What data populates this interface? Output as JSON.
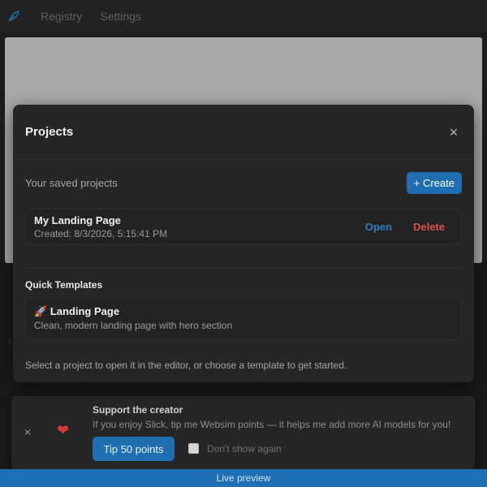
{
  "topbar": {
    "logo_icon": "feather-icon",
    "accent": "#1f6fb0",
    "nav": [
      "Registry",
      "Settings"
    ]
  },
  "modal": {
    "title": "Projects",
    "close_label": "×",
    "saved_label": "Your saved projects",
    "create_label": "+ Create",
    "projects": [
      {
        "name": "My Landing Page",
        "created": "Created: 8/3/2026, 5:15:41 PM",
        "open_label": "Open",
        "delete_label": "Delete"
      }
    ],
    "templates_heading": "Quick Templates",
    "templates": [
      {
        "emoji": "🚀",
        "name": "Landing Page",
        "description": "Clean, modern landing page with hero section"
      }
    ],
    "footnote": "Select a project to open it in the editor, or choose a template to get started."
  },
  "toast": {
    "close_label": "×",
    "heart": "❤",
    "title": "Support the creator",
    "text": "If you enjoy Slick, tip me Websim points — it helps me add more AI models for you!",
    "tip_label": "Tip 50 points",
    "dont_show_label": "Don't show again"
  },
  "background": {
    "ghost_letter": "I"
  },
  "live_preview_label": "Live preview"
}
